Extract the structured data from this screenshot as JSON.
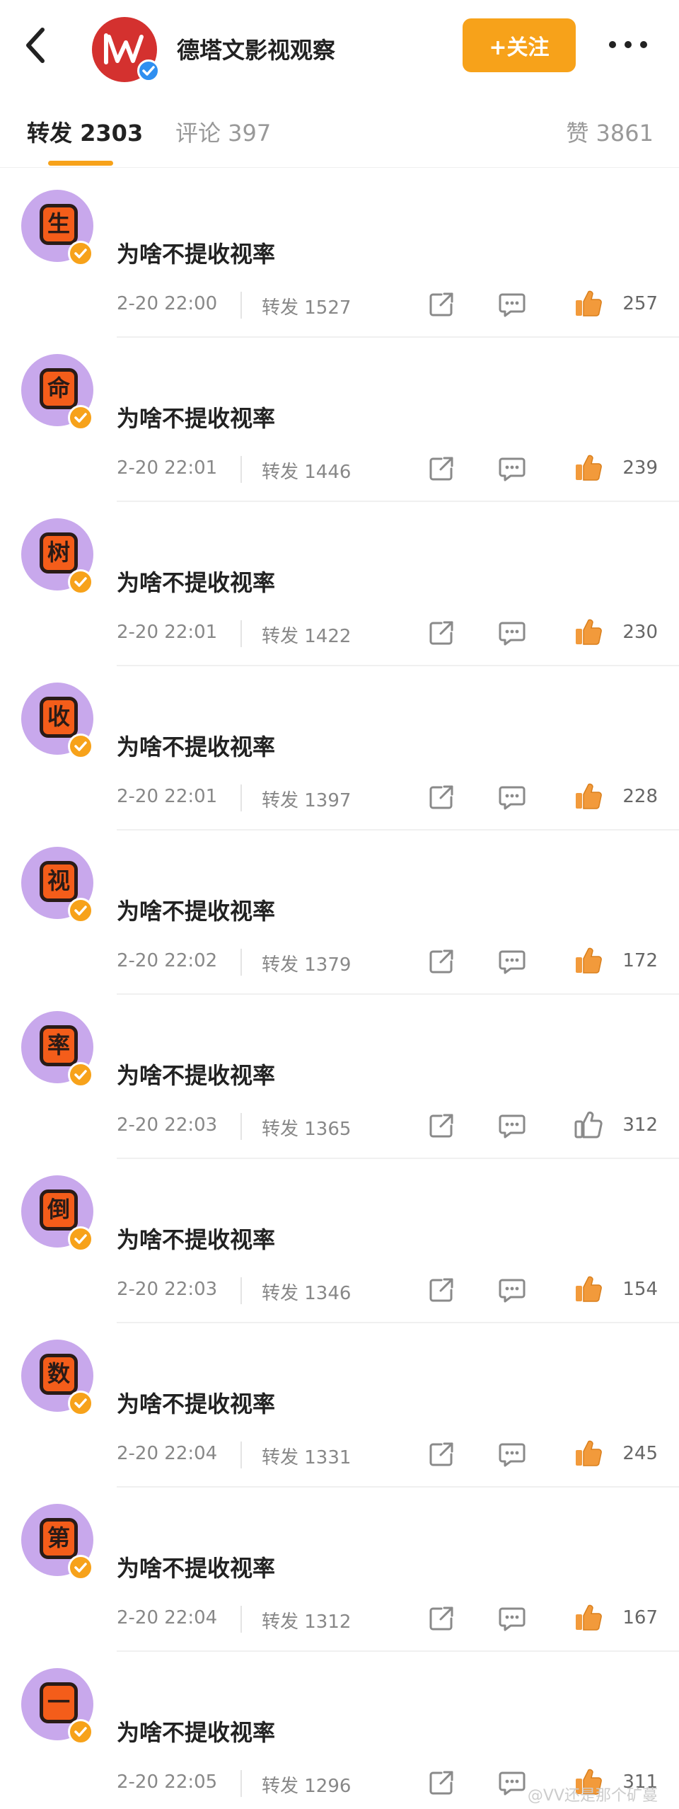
{
  "header": {
    "account_name": "德塔文影视观察",
    "follow_label": "+关注",
    "back_icon": "chevron-left-icon",
    "more_icon": "more-dots-icon",
    "avatar_color": "#d4312f",
    "verify_color": "#2f8ff0",
    "follow_color": "#f7a21a"
  },
  "tabs": {
    "repost": "转发 2303",
    "comment": "评论 397",
    "like": "赞 3861",
    "active": "repost"
  },
  "items": [
    {
      "avatar_char": "生",
      "text": "为啥不提收视率",
      "time": "2-20 22:00",
      "repost": "转发 1527",
      "likes": "257",
      "liked": true
    },
    {
      "avatar_char": "命",
      "text": "为啥不提收视率",
      "time": "2-20 22:01",
      "repost": "转发 1446",
      "likes": "239",
      "liked": true
    },
    {
      "avatar_char": "树",
      "text": "为啥不提收视率",
      "time": "2-20 22:01",
      "repost": "转发 1422",
      "likes": "230",
      "liked": true
    },
    {
      "avatar_char": "收",
      "text": "为啥不提收视率",
      "time": "2-20 22:01",
      "repost": "转发 1397",
      "likes": "228",
      "liked": true
    },
    {
      "avatar_char": "视",
      "text": "为啥不提收视率",
      "time": "2-20 22:02",
      "repost": "转发 1379",
      "likes": "172",
      "liked": true
    },
    {
      "avatar_char": "率",
      "text": "为啥不提收视率",
      "time": "2-20 22:03",
      "repost": "转发 1365",
      "likes": "312",
      "liked": false
    },
    {
      "avatar_char": "倒",
      "text": "为啥不提收视率",
      "time": "2-20 22:03",
      "repost": "转发 1346",
      "likes": "154",
      "liked": true
    },
    {
      "avatar_char": "数",
      "text": "为啥不提收视率",
      "time": "2-20 22:04",
      "repost": "转发 1331",
      "likes": "245",
      "liked": true
    },
    {
      "avatar_char": "第",
      "text": "为啥不提收视率",
      "time": "2-20 22:04",
      "repost": "转发 1312",
      "likes": "167",
      "liked": true
    },
    {
      "avatar_char": "一",
      "text": "为啥不提收视率",
      "time": "2-20 22:05",
      "repost": "转发 1296",
      "likes": "311",
      "liked": true
    }
  ],
  "watermark": "@VV还是那个矿蔓",
  "colors": {
    "accent": "#f7a21a",
    "like_active": "#f29a3b",
    "avatar_bg": "#c8a8ec"
  }
}
